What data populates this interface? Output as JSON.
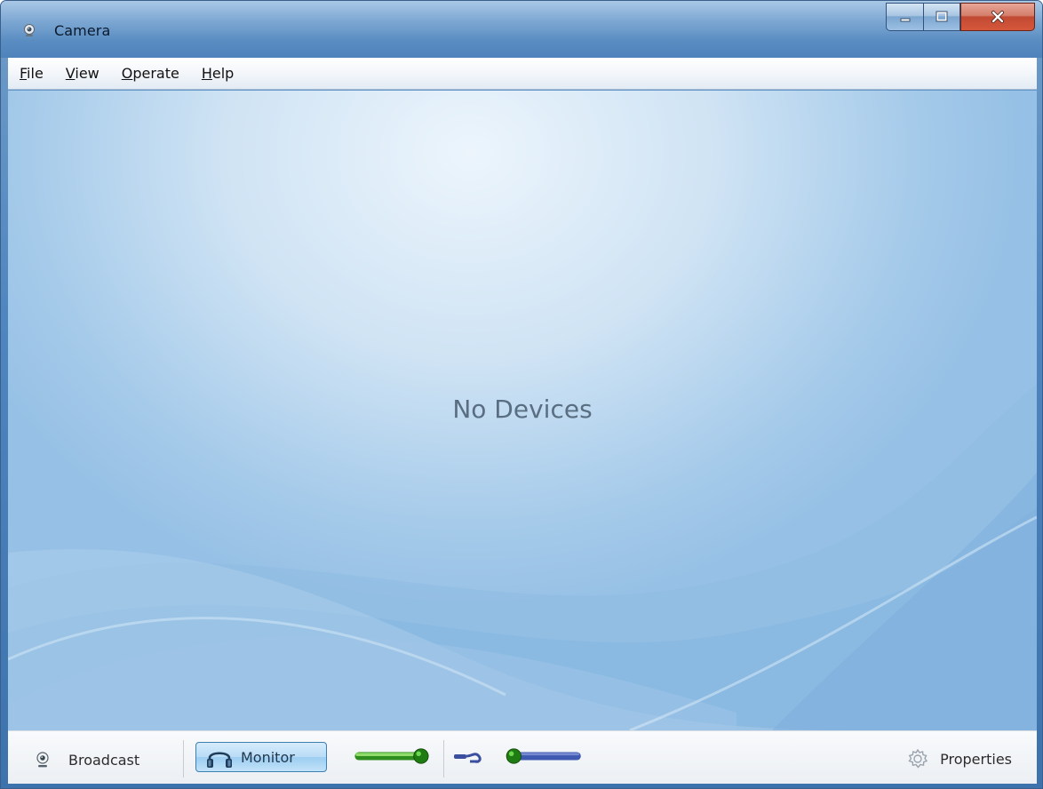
{
  "window": {
    "title": "Camera",
    "icon": "webcam-icon"
  },
  "caption_buttons": {
    "minimize_icon": "minimize-icon",
    "maximize_icon": "maximize-icon",
    "close_icon": "close-icon"
  },
  "menu": {
    "items": [
      {
        "accel": "F",
        "rest": "ile"
      },
      {
        "accel": "V",
        "rest": "iew"
      },
      {
        "accel": "O",
        "rest": "perate"
      },
      {
        "accel": "H",
        "rest": "elp"
      }
    ]
  },
  "main": {
    "message": "No Devices"
  },
  "statusbar": {
    "broadcast_label": "Broadcast",
    "monitor_label": "Monitor",
    "properties_label": "Properties",
    "volume_level": 1.0,
    "mic_level": 0.0
  },
  "colors": {
    "slider_green": "#3aa62a",
    "slider_blue": "#3f58b0",
    "accent": "#3c7fb1"
  }
}
